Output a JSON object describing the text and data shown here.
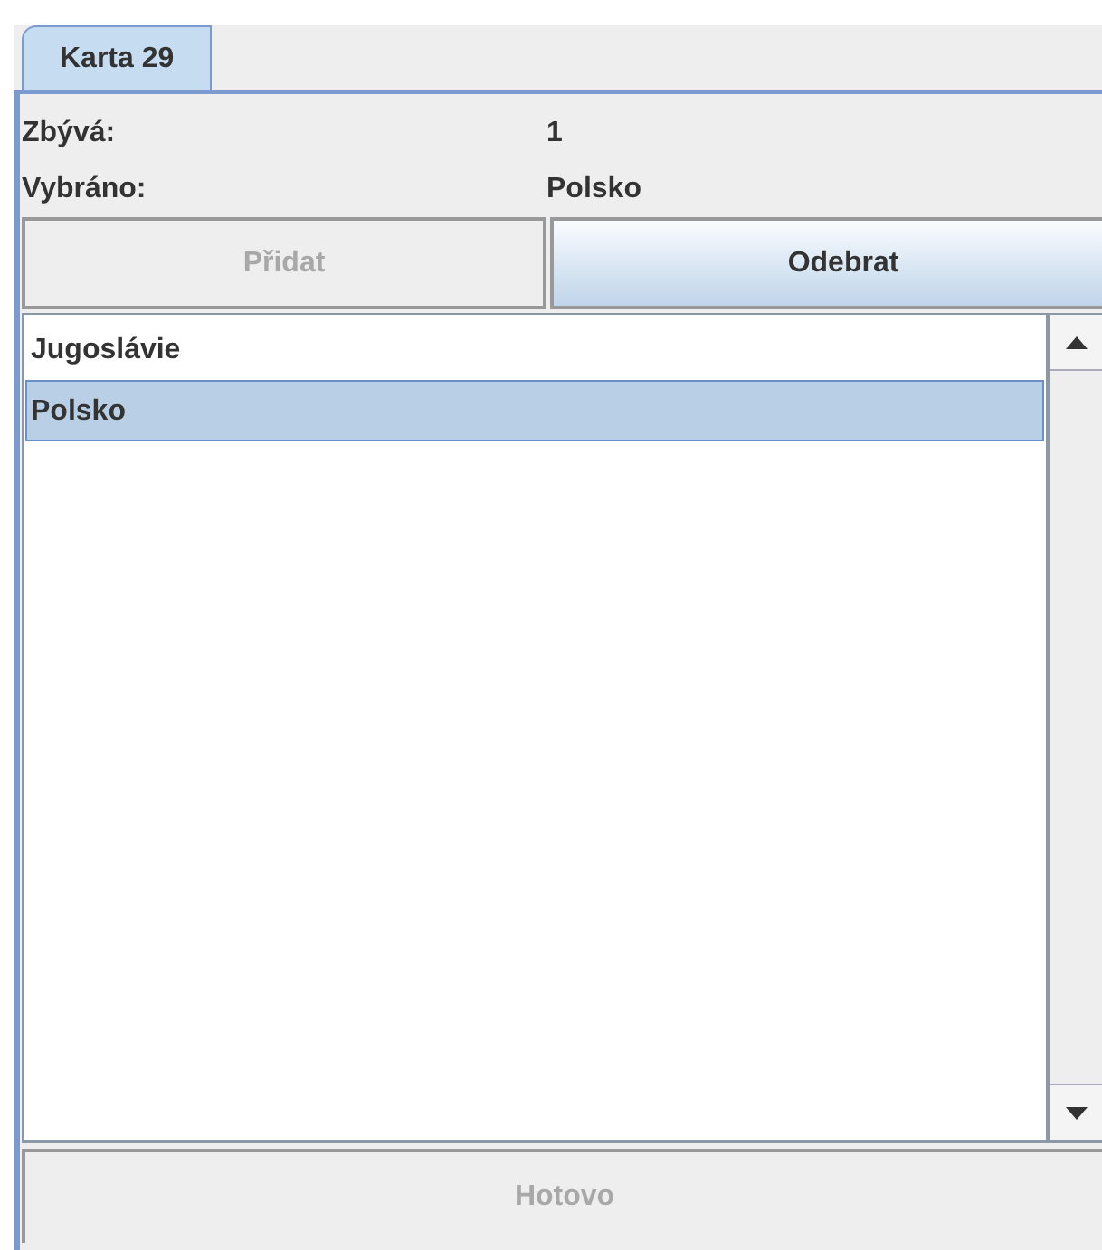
{
  "tabs": [
    {
      "label": "Karta 29",
      "selected": true
    }
  ],
  "info": [
    {
      "label": "Zbývá:",
      "value": "1"
    },
    {
      "label": "Vybráno:",
      "value": "Polsko"
    }
  ],
  "buttons": [
    {
      "label": "Přidat",
      "disabled": true
    },
    {
      "label": "Odebrat",
      "disabled": false
    }
  ],
  "list": [
    {
      "label": "Jugoslávie",
      "selected": false
    },
    {
      "label": "Polsko",
      "selected": true
    }
  ],
  "done_button": {
    "label": "Hotovo",
    "disabled": true
  }
}
